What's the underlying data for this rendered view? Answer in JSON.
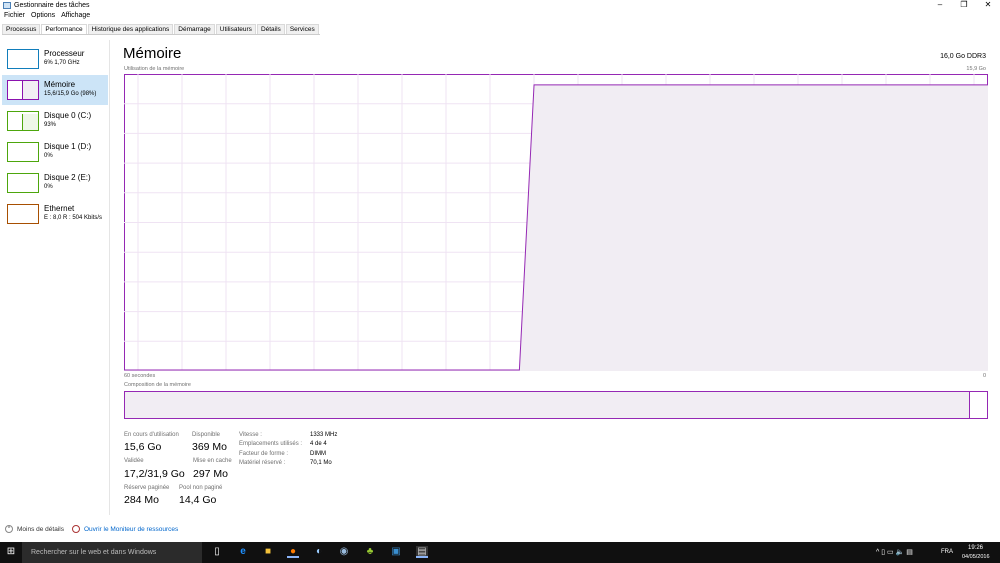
{
  "window": {
    "title": "Gestionnaire des tâches"
  },
  "menu": [
    "Fichier",
    "Options",
    "Affichage"
  ],
  "tabs": [
    "Processus",
    "Performance",
    "Historique des applications",
    "Démarrage",
    "Utilisateurs",
    "Détails",
    "Services"
  ],
  "active_tab": "Performance",
  "sidebar": [
    {
      "name": "Processeur",
      "sub": "6% 1,70 GHz",
      "color": "#117dbb"
    },
    {
      "name": "Mémoire",
      "sub": "15,6/15,9 Go (98%)",
      "color": "#8b12ae"
    },
    {
      "name": "Disque 0 (C:)",
      "sub": "93%",
      "color": "#4da60c"
    },
    {
      "name": "Disque 1 (D:)",
      "sub": "0%",
      "color": "#4da60c"
    },
    {
      "name": "Disque 2 (E:)",
      "sub": "0%",
      "color": "#4da60c"
    },
    {
      "name": "Ethernet",
      "sub": "E : 8,0 R : 504 Kbits/s",
      "color": "#a74f01"
    }
  ],
  "main": {
    "title": "Mémoire",
    "type": "16,0 Go DDR3",
    "graph_label": "Utilisation de la mémoire",
    "graph_max": "15,9 Go",
    "time_left": "60 secondes",
    "time_right": "0",
    "composition_label": "Composition de la mémoire",
    "memory_usage_percent_series": [
      0,
      0,
      0,
      0,
      0,
      0,
      0,
      0,
      0,
      0,
      0,
      0,
      0,
      0,
      0,
      0,
      0,
      0,
      0,
      0,
      0,
      0,
      0,
      0,
      0,
      0,
      0,
      0,
      98,
      98,
      98,
      98,
      98,
      98,
      98,
      98,
      98,
      98,
      98,
      98,
      98,
      98,
      98,
      98,
      98,
      98,
      98,
      98,
      98,
      98,
      98,
      98,
      98,
      98,
      98,
      98,
      98,
      98,
      98,
      98
    ],
    "composition_in_use_fraction": 0.98,
    "stats": {
      "in_use_label": "En cours d'utilisation",
      "in_use": "15,6 Go",
      "available_label": "Disponible",
      "available": "369 Mo",
      "committed_label": "Validée",
      "committed": "17,2/31,9 Go",
      "cached_label": "Mise en cache",
      "cached": "297 Mo",
      "paged_label": "Réserve paginée",
      "paged": "284 Mo",
      "nonpaged_label": "Pool non paginé",
      "nonpaged": "14,4 Go"
    },
    "props": [
      {
        "k": "Vitesse :",
        "v": "1333 MHz"
      },
      {
        "k": "Emplacements utilisés :",
        "v": "4 de 4"
      },
      {
        "k": "Facteur de forme :",
        "v": "DIMM"
      },
      {
        "k": "Matériel réservé :",
        "v": "70,1 Mo"
      }
    ]
  },
  "footer": {
    "less": "Moins de détails",
    "monitor": "Ouvrir le Moniteur de ressources"
  },
  "taskbar": {
    "search": "Rechercher sur le web et dans Windows",
    "lang": "FRA",
    "time": "19:26",
    "date": "04/05/2016"
  }
}
